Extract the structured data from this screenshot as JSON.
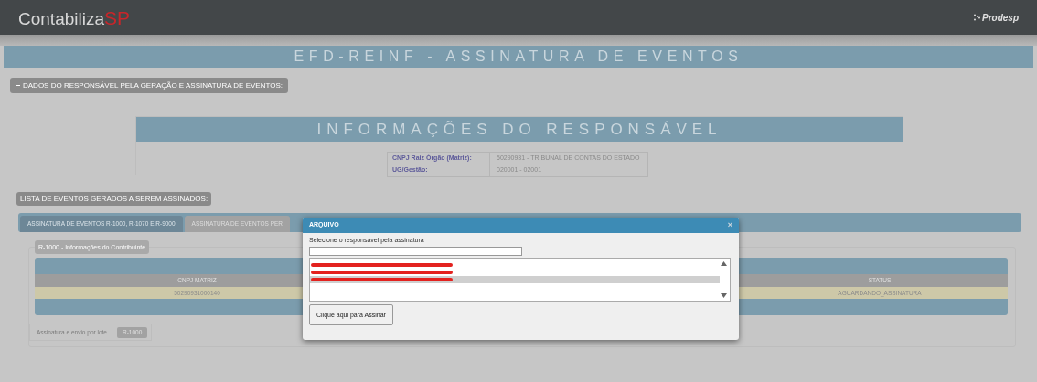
{
  "header": {
    "logo_main": "Contabiliza",
    "logo_accent": "SP",
    "partner": "Prodesp"
  },
  "page_title": "EFD-REINF - ASSINATURA DE EVENTOS",
  "responsible_section": {
    "toggle": "DADOS DO RESPONSÁVEL PELA GERAÇÃO E ASSINATURA DE EVENTOS:",
    "title": "INFORMAÇÕES DO RESPONSÁVEL",
    "rows": [
      {
        "label": "CNPJ Raiz Órgão (Matriz):",
        "value": "50290931 - TRIBUNAL DE CONTAS DO ESTADO"
      },
      {
        "label": "UG/Gestão:",
        "value": "020001 - 02001"
      }
    ]
  },
  "events_section": {
    "legend": "LISTA DE EVENTOS GERADOS A SEREM ASSINADOS:",
    "tabs": [
      {
        "label": "ASSINATURA DE EVENTOS R-1000, R-1070 E R-9000",
        "selected": true
      },
      {
        "label": "ASSINATURA DE EVENTOS PER",
        "selected": false
      }
    ],
    "panel_legend": "R-1000 - Informações do Contribuinte",
    "table": {
      "columns": [
        "CNPJ MATRIZ",
        "STATUS"
      ],
      "rows": [
        [
          "50290931000140",
          "AGUARDANDO_ASSINATURA"
        ]
      ]
    },
    "batch_label": "Assinatura e envio por lote",
    "batch_button": "R-1000"
  },
  "dialog": {
    "title": "ARQUIVO",
    "close": "×",
    "prompt": "Selecione o responsável pela assinatura",
    "options": [
      {
        "selected": false
      },
      {
        "selected": false
      },
      {
        "selected": true
      }
    ],
    "sign_button": "Clique aqui para Assinar"
  }
}
